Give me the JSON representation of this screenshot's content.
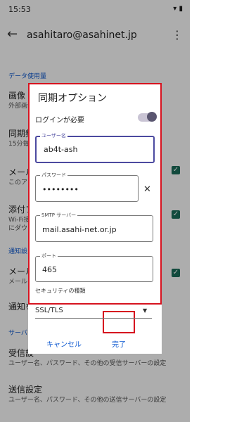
{
  "status_bar": {
    "time": "15:53",
    "icons": "▾ ▮"
  },
  "appbar": {
    "back_icon": "←",
    "title": "asahitaro@asahinet.jp",
    "more_icon": "⋮"
  },
  "settings": {
    "data_usage_head": "データ使用量",
    "image_title": "画像",
    "image_sub": "外部画像",
    "sync_title": "同期頻",
    "sync_sub": "15分毎",
    "mail_title": "メール",
    "mail_sub": "このア",
    "attach_title": "添付フ",
    "attach_sub1": "Wi-Fi接",
    "attach_sub2": "にダウ",
    "notify_head": "通知設",
    "notify_mail_title": "メール",
    "notify_mail_sub": "メール",
    "notify_set_title": "通知を",
    "server_head": "サーバ",
    "incoming_title": "受信設",
    "incoming_sub": "ユーザー名、パスワード、その他の受信サーバーの設定",
    "outgoing_title": "送信設定",
    "outgoing_sub": "ユーザー名、パスワード、その他の送信サーバーの設定"
  },
  "dialog": {
    "title": "同期オプション",
    "login_required": "ログインが必要",
    "login_switch_on": true,
    "username_label": "ユーザー名",
    "username_value": "ab4t-ash",
    "password_label": "パスワード",
    "password_value": "••••••••",
    "clear_icon": "✕",
    "smtp_label": "SMTP サーバー",
    "smtp_value": "mail.asahi-net.or.jp",
    "port_label": "ポート",
    "port_value": "465",
    "security_label": "セキュリティの種類",
    "security_value": "SSL/TLS",
    "dropdown_icon": "▼",
    "cancel_label": "キャンセル",
    "done_label": "完了"
  },
  "colors": {
    "highlight": "#d6131f",
    "accent": "#0b57d0",
    "focus": "#4c4aa0"
  }
}
